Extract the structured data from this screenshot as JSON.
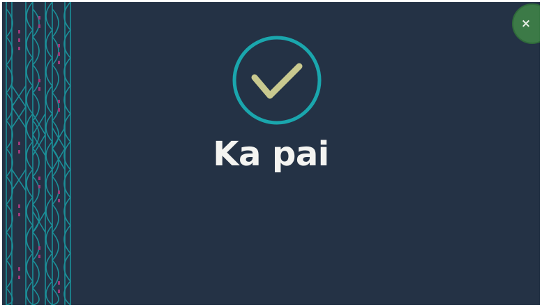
{
  "dialog": {
    "title": "Ka pai",
    "close_icon": "close-icon",
    "status_icon": "checkmark-icon"
  },
  "colors": {
    "background": "#243245",
    "ring": "#1aa6ad",
    "check": "#c9c98f",
    "title": "#f4f4f1",
    "close_button": "#3c7a47",
    "pattern_line": "#1b8f98",
    "pattern_accent": "#9b3a7a"
  },
  "close_button": {
    "label": "×"
  }
}
